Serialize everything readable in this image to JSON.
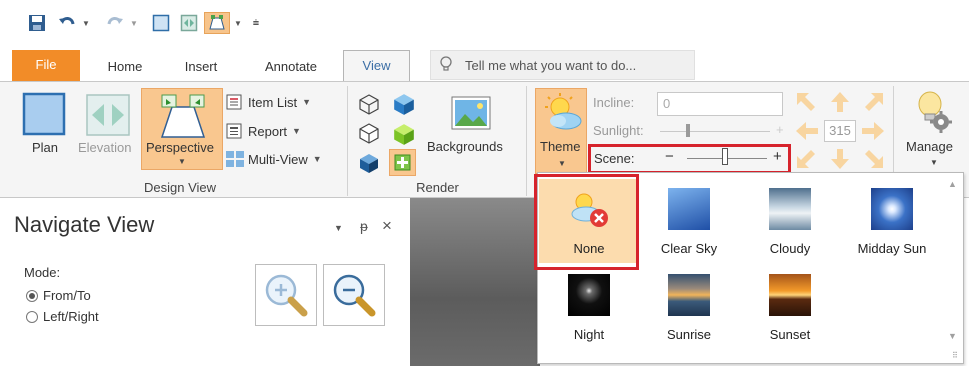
{
  "tabs": {
    "file": "File",
    "home": "Home",
    "insert": "Insert",
    "annotate": "Annotate",
    "view": "View"
  },
  "tellme": {
    "placeholder": "Tell me what you want to do..."
  },
  "ribbon": {
    "design_view": {
      "label": "Design View",
      "plan": "Plan",
      "elevation": "Elevation",
      "perspective": "Perspective",
      "item_list": "Item List",
      "report": "Report",
      "multi_view": "Multi-View"
    },
    "render": {
      "label": "Render",
      "backgrounds": "Backgrounds"
    },
    "theme": {
      "theme_label": "Theme",
      "incline_label": "Incline:",
      "incline_value": "0",
      "sunlight_label": "Sunlight:",
      "scene_label": "Scene:",
      "scene_minus": "−",
      "scene_plus": "+",
      "sunlight_plus": "+",
      "rotation_value": "315"
    },
    "manage": {
      "label": "Manage"
    }
  },
  "navigate": {
    "title": "Navigate View",
    "mode_label": "Mode:",
    "option_from_to": "From/To",
    "option_left_right": "Left/Right",
    "pin_glyph": "ᵽ",
    "close_glyph": "×",
    "menu_glyph": "▼"
  },
  "gallery": {
    "items": [
      {
        "name": "None",
        "selected": true
      },
      {
        "name": "Clear Sky",
        "selected": false
      },
      {
        "name": "Cloudy",
        "selected": false
      },
      {
        "name": "Midday Sun",
        "selected": false
      },
      {
        "name": "Night",
        "selected": false
      },
      {
        "name": "Sunrise",
        "selected": false
      },
      {
        "name": "Sunset",
        "selected": false
      }
    ]
  },
  "colors": {
    "file_tab": "#f28c28",
    "active_tab_text": "#3b6ea5",
    "highlight": "#fcdcae",
    "annotation_red": "#d6232c"
  }
}
